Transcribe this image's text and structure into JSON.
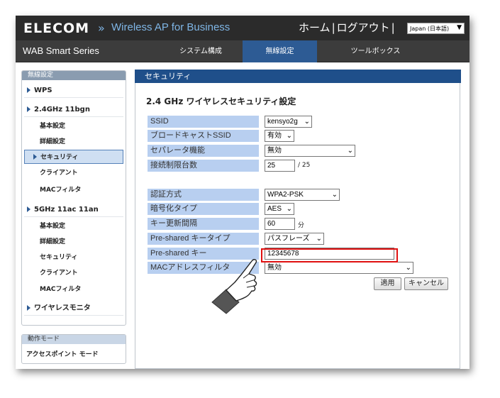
{
  "header": {
    "logo": "ELECOM",
    "product": "Wireless AP for Business",
    "home": "ホーム",
    "logout": "ログアウト",
    "separator": "|",
    "language": "Japan (日本語)"
  },
  "nav": {
    "series": "WAB Smart Series",
    "tabs": [
      {
        "label": "システム構成"
      },
      {
        "label": "無線設定"
      },
      {
        "label": "ツールボックス"
      }
    ]
  },
  "sidebar": {
    "title": "無線設定",
    "items": [
      {
        "label": "WPS"
      },
      {
        "label": "2.4GHz 11bgn"
      },
      {
        "label": "基本設定"
      },
      {
        "label": "詳細設定"
      },
      {
        "label": "セキュリティ"
      },
      {
        "label": "クライアント"
      },
      {
        "label": "MACフィルタ"
      },
      {
        "label": "5GHz 11ac 11an"
      },
      {
        "label": "基本設定"
      },
      {
        "label": "詳細設定"
      },
      {
        "label": "セキュリティ"
      },
      {
        "label": "クライアント"
      },
      {
        "label": "MACフィルタ"
      },
      {
        "label": "ワイヤレスモニタ"
      }
    ],
    "mode_title": "動作モード",
    "mode_value": "アクセスポイント モード"
  },
  "main": {
    "header": "セキュリティ",
    "section_title": "2.4 GHz ワイヤレスセキュリティ設定",
    "fields": {
      "ssid_label": "SSID",
      "ssid_value": "kensyo2g",
      "broadcast_label": "ブロードキャストSSID",
      "broadcast_value": "有効",
      "separator_label": "セパレータ機能",
      "separator_value": "無効",
      "conn_limit_label": "接続制限台数",
      "conn_limit_value": "25",
      "conn_limit_max": "/ 25",
      "auth_label": "認証方式",
      "auth_value": "WPA2-PSK",
      "enc_label": "暗号化タイプ",
      "enc_value": "AES",
      "key_update_label": "キー更新間隔",
      "key_update_value": "60",
      "key_update_unit": "分",
      "psk_type_label": "Pre-shared キータイプ",
      "psk_type_value": "パスフレーズ",
      "psk_label": "Pre-shared キー",
      "psk_value": "12345678",
      "mac_filter_label": "MACアドレスフィルタ",
      "mac_filter_value": "無効"
    },
    "apply": "適用",
    "cancel": "キャンセル"
  },
  "colors": {
    "header_bg": "#2b2b2b",
    "accent": "#2d5b94",
    "label_bg": "#b8cff0",
    "highlight": "#e01010"
  }
}
